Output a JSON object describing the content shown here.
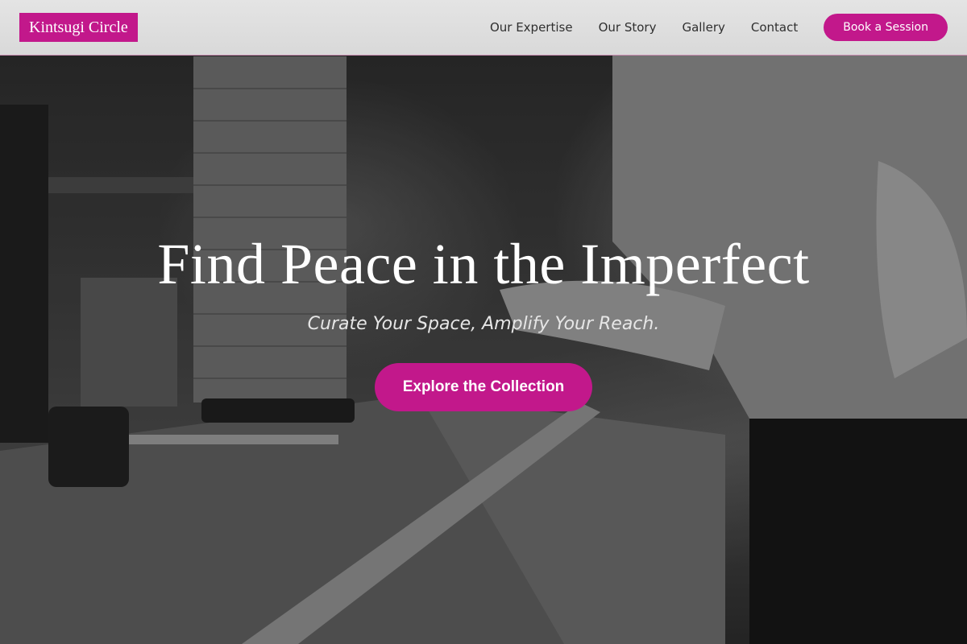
{
  "header": {
    "logo_text": "Kintsugi Circle",
    "nav": [
      {
        "label": "Our Expertise"
      },
      {
        "label": "Our Story"
      },
      {
        "label": "Gallery"
      },
      {
        "label": "Contact"
      }
    ],
    "cta_label": "Book a Session"
  },
  "hero": {
    "title": "Find Peace in the Imperfect",
    "subtitle": "Curate Your Space, Amplify Your Reach.",
    "cta_label": "Explore the Collection"
  },
  "colors": {
    "accent": "#c2188b",
    "header_bg": "#dedede",
    "nav_text": "#2f2f2f"
  }
}
